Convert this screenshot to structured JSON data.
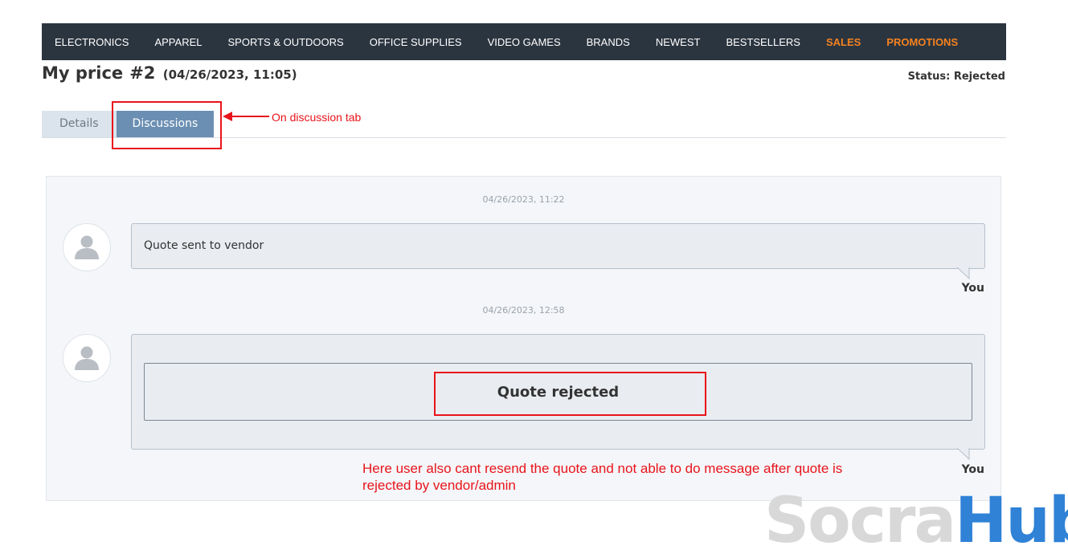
{
  "nav": {
    "items": [
      "ELECTRONICS",
      "APPAREL",
      "SPORTS & OUTDOORS",
      "OFFICE SUPPLIES",
      "VIDEO GAMES",
      "BRANDS",
      "NEWEST",
      "BESTSELLERS"
    ],
    "accent_items": [
      "SALES",
      "PROMOTIONS"
    ],
    "accent_color": "#f5821f",
    "background": "#2b3540"
  },
  "header": {
    "title": "My price",
    "number": "#2",
    "date": "(04/26/2023, 11:05)",
    "status": "Status: Rejected"
  },
  "tabs": [
    {
      "label": "Details",
      "active": false
    },
    {
      "label": "Discussions",
      "active": true
    }
  ],
  "annotations": {
    "tab_note": "On discussion tab",
    "bottom_note": "Here user also cant resend the quote and not able to do message after quote is rejected by vendor/admin",
    "color": "#e8141b"
  },
  "messages": [
    {
      "date": "04/26/2023, 11:22",
      "text": "Quote sent to vendor",
      "author": "You"
    },
    {
      "date": "04/26/2023, 12:58",
      "text": "Quote rejected",
      "author": "You"
    }
  ],
  "watermark": {
    "part1": "Socra",
    "part2": "Hub"
  },
  "icons": {
    "avatar": "user-silhouette-icon",
    "arrow": "arrow-left-icon"
  }
}
